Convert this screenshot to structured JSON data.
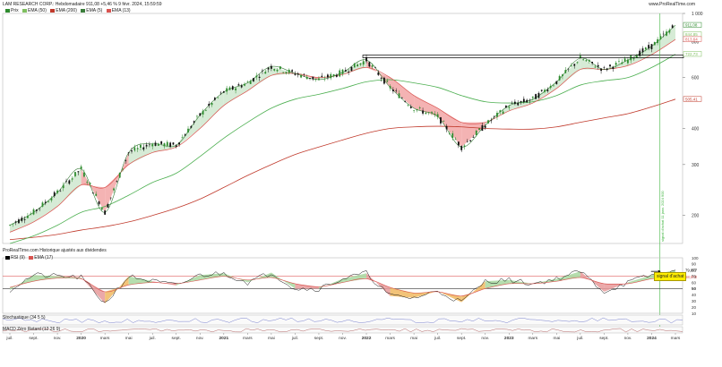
{
  "header": {
    "title": "LAM RESEARCH CORP.: Hebdomadaire 911,08 +5,46 % 9 févr. 2024, 15:59:59",
    "watermark": "www.ProRealTime.com",
    "legend": [
      {
        "label": "Prix",
        "color": "#2e8b2e"
      },
      {
        "label": "EMA (50)",
        "color": "#7fbf5f"
      },
      {
        "label": "EMA (200)",
        "color": "#c0392b"
      },
      {
        "label": "EMA (5)",
        "color": "#3a7d3a"
      },
      {
        "label": "EMA (13)",
        "color": "#d9534f"
      }
    ]
  },
  "panels": {
    "source_note": "ProRealTime.com Historique ajustés aux dividendes",
    "rsi_legend": [
      {
        "label": "RSI (9)",
        "color": "#000000"
      },
      {
        "label": "EMA (17)",
        "color": "#d9534f"
      }
    ],
    "signal_label": "signal d'achat",
    "vertical_label": "signal d'achat 11 janv. 2024 900",
    "stochastic_label": "Stochastique (34 5 5)",
    "macd_label": "MACD Zéro Retard (12 26 9)"
  },
  "chart_data": [
    {
      "type": "line",
      "title": "LAM RESEARCH CORP.",
      "price_scale": "log",
      "ylim": [
        160,
        1000
      ],
      "yticks": [
        1000,
        800,
        600,
        400,
        300,
        200
      ],
      "price_labels": [
        {
          "value": "911,08",
          "color": "#2e8b2e"
        },
        {
          "value": "844,85",
          "color": "#7fbf5f"
        },
        {
          "value": "813,64",
          "color": "#d9534f"
        },
        {
          "value": "722,73",
          "color": "#7fbf5f"
        },
        {
          "value": "505,41",
          "color": "#c0392b"
        }
      ],
      "xticks": [
        "juil.",
        "sept.",
        "nov.",
        "2020",
        "mars",
        "mai",
        "juil.",
        "sept.",
        "nov.",
        "2021",
        "mars",
        "mai",
        "juil.",
        "sept.",
        "nov.",
        "2022",
        "mars",
        "mai",
        "juil.",
        "sept.",
        "nov.",
        "2023",
        "mars",
        "mai",
        "juil.",
        "sept.",
        "nov.",
        "2024",
        "mars"
      ],
      "x": [
        "2019-07",
        "2019-09",
        "2019-11",
        "2020-01",
        "2020-03",
        "2020-05",
        "2020-07",
        "2020-09",
        "2020-11",
        "2021-01",
        "2021-03",
        "2021-05",
        "2021-07",
        "2021-09",
        "2021-11",
        "2022-01",
        "2022-03",
        "2022-05",
        "2022-07",
        "2022-09",
        "2022-11",
        "2023-01",
        "2023-03",
        "2023-05",
        "2023-07",
        "2023-09",
        "2023-11",
        "2024-01",
        "2024-02"
      ],
      "series": [
        {
          "values": [
            185,
            205,
            240,
            290,
            205,
            330,
            355,
            350,
            445,
            535,
            575,
            655,
            620,
            590,
            625,
            690,
            555,
            470,
            440,
            345,
            410,
            480,
            505,
            580,
            700,
            640,
            690,
            770,
            911
          ]
        },
        {
          "values": [
            175,
            190,
            215,
            255,
            250,
            300,
            330,
            345,
            400,
            480,
            540,
            610,
            620,
            600,
            615,
            650,
            600,
            520,
            470,
            420,
            420,
            460,
            490,
            550,
            640,
            640,
            660,
            720,
            813
          ]
        },
        {
          "values": [
            160,
            170,
            185,
            205,
            215,
            235,
            260,
            280,
            320,
            370,
            420,
            470,
            505,
            525,
            550,
            580,
            590,
            575,
            555,
            520,
            495,
            490,
            495,
            520,
            565,
            585,
            600,
            650,
            722
          ]
        },
        {
          "values": [
            165,
            168,
            172,
            178,
            183,
            190,
            200,
            212,
            228,
            250,
            275,
            300,
            325,
            345,
            365,
            385,
            400,
            405,
            407,
            405,
            400,
            398,
            398,
            405,
            420,
            435,
            450,
            475,
            505
          ]
        }
      ],
      "resistance_level": 710,
      "buy_signal": {
        "date": "2024-01-11",
        "price": 900
      }
    },
    {
      "type": "line",
      "title": "RSI (9)",
      "ylim": [
        10,
        100
      ],
      "yticks": [
        100,
        90,
        80,
        70,
        60,
        50,
        40,
        30,
        20,
        10
      ],
      "levels": [
        70,
        50
      ],
      "value_labels": [
        "79,877",
        "68,972"
      ],
      "x": [
        "2019-07",
        "2019-09",
        "2019-11",
        "2020-01",
        "2020-03",
        "2020-05",
        "2020-07",
        "2020-09",
        "2020-11",
        "2021-01",
        "2021-03",
        "2021-05",
        "2021-07",
        "2021-09",
        "2021-11",
        "2022-01",
        "2022-03",
        "2022-05",
        "2022-07",
        "2022-09",
        "2022-11",
        "2023-01",
        "2023-03",
        "2023-05",
        "2023-07",
        "2023-09",
        "2023-11",
        "2024-01",
        "2024-02"
      ],
      "series": [
        {
          "values": [
            48,
            72,
            70,
            68,
            26,
            70,
            62,
            55,
            72,
            75,
            60,
            76,
            50,
            50,
            66,
            75,
            38,
            35,
            46,
            28,
            62,
            64,
            58,
            66,
            78,
            45,
            60,
            72,
            80
          ]
        },
        {
          "values": [
            52,
            62,
            67,
            66,
            45,
            56,
            60,
            58,
            64,
            70,
            64,
            68,
            58,
            53,
            60,
            66,
            52,
            43,
            45,
            38,
            50,
            58,
            58,
            62,
            68,
            58,
            58,
            66,
            69
          ]
        }
      ]
    }
  ]
}
